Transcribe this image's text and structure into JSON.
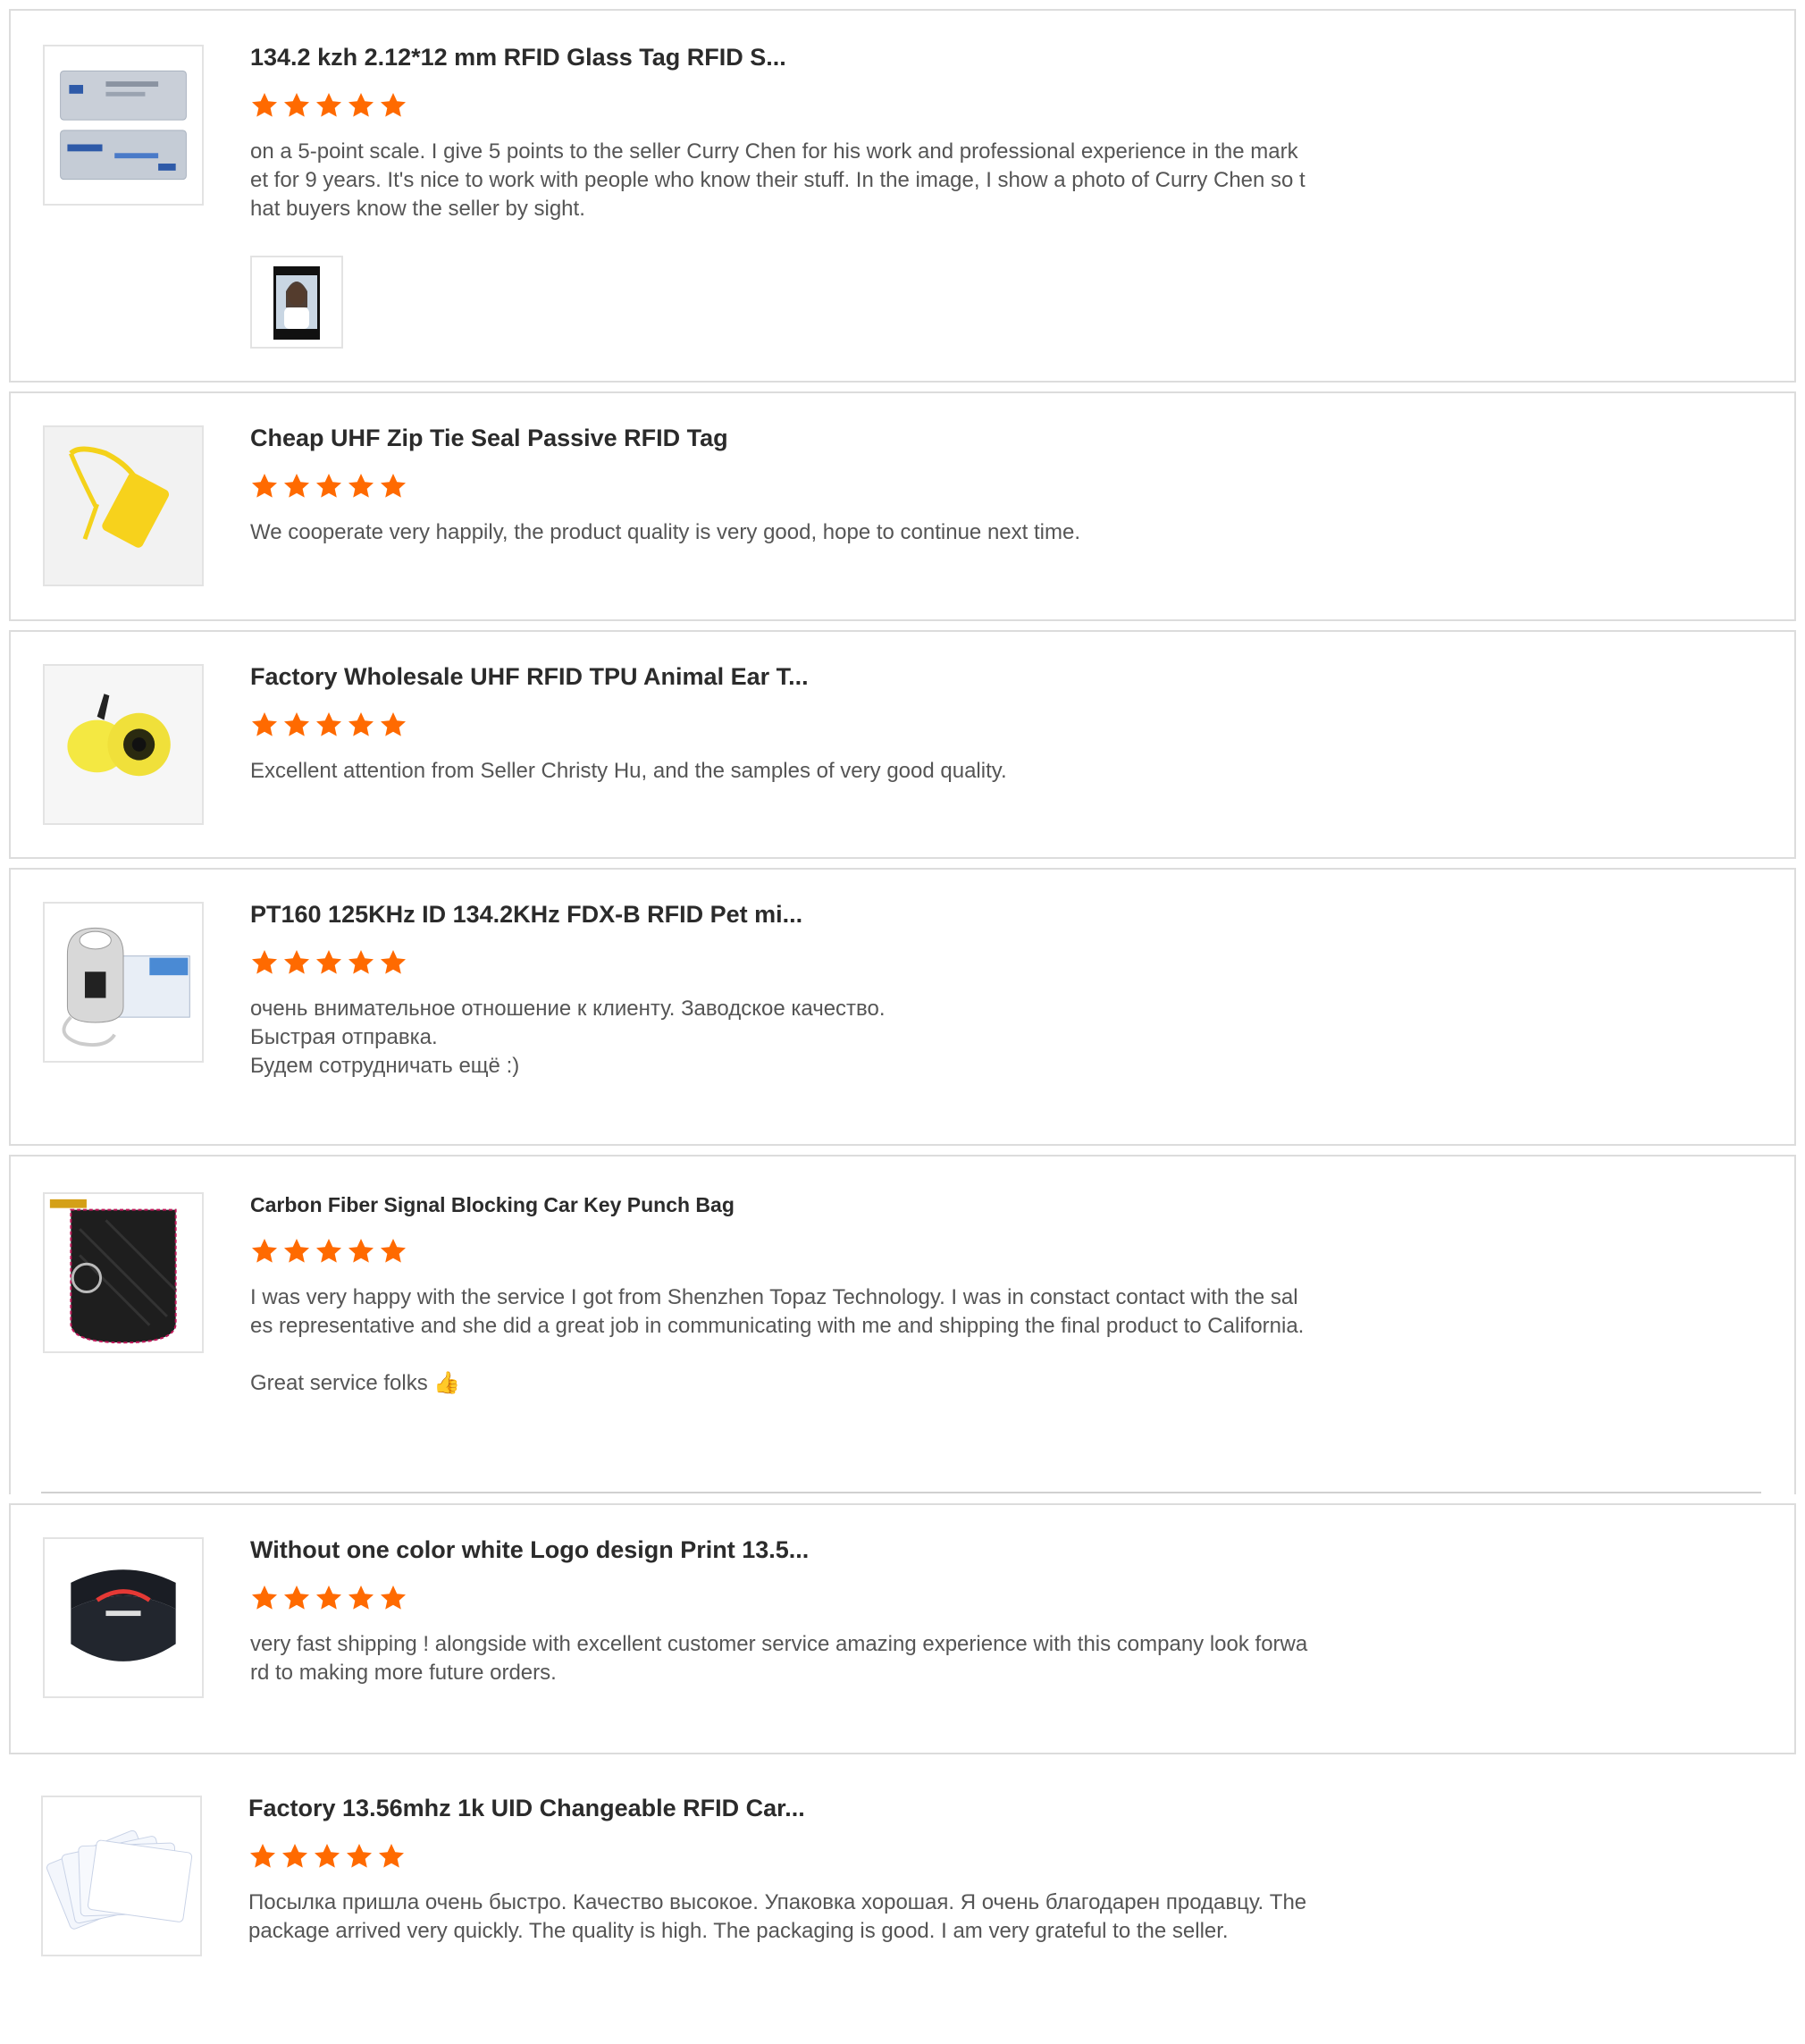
{
  "star_color": "#ff6a00",
  "star_icon": "star-icon",
  "reviews": [
    {
      "title": "134.2 kzh 2.12*12 mm RFID Glass Tag RFID S...",
      "rating": 5,
      "text": "on a 5-point scale. I give 5 points to the seller Curry Chen for his work and professional experience in the market for 9 years. It's nice to work with people who know their stuff. In the image, I show a photo of Curry Chen so that buyers know the seller by sight.",
      "thumbnail_icon": "glass-tag-package-icon",
      "attachment_icon": "seller-photo-icon"
    },
    {
      "title": "Cheap UHF Zip Tie Seal Passive RFID Tag",
      "rating": 5,
      "text": "We cooperate very happily, the product quality is very good, hope to continue next time.",
      "thumbnail_icon": "zip-tie-tag-icon"
    },
    {
      "title": "Factory Wholesale UHF RFID TPU Animal Ear T...",
      "rating": 5,
      "text": "Excellent attention from Seller Christy Hu, and the samples of very good quality.",
      "thumbnail_icon": "ear-tag-icon"
    },
    {
      "title": "PT160 125KHz ID 134.2KHz FDX-B RFID Pet mi...",
      "rating": 5,
      "text": "очень внимательное отношение к клиенту. Заводское качество.\nБыстрая отправка.\nБудем сотрудничать ещё :)",
      "thumbnail_icon": "pet-scanner-icon"
    },
    {
      "title": "Carbon Fiber Signal Blocking Car Key Punch Bag",
      "rating": 5,
      "text": "I was very happy with the service I got from Shenzhen Topaz Technology. I was in constact contact with the sales representative and she did a great job in communicating with me and shipping the final product to California.\n\nGreat service folks 👍",
      "thumbnail_icon": "key-pouch-icon"
    },
    {
      "title": "Without one color white Logo design Print 13.5...",
      "rating": 5,
      "text": "very fast shipping ! alongside with excellent customer service amazing experience with this company look forward to making more future orders.",
      "thumbnail_icon": "wristband-icon"
    },
    {
      "title": "Factory 13.56mhz 1k UID Changeable RFID Car...",
      "rating": 5,
      "text": "Посылка пришла очень быстро. Качество высокое. Упаковка хорошая. Я очень благодарен продавцу. The package arrived very quickly. The quality is high. The packaging is good. I am very grateful to the seller.",
      "thumbnail_icon": "white-cards-icon"
    }
  ]
}
